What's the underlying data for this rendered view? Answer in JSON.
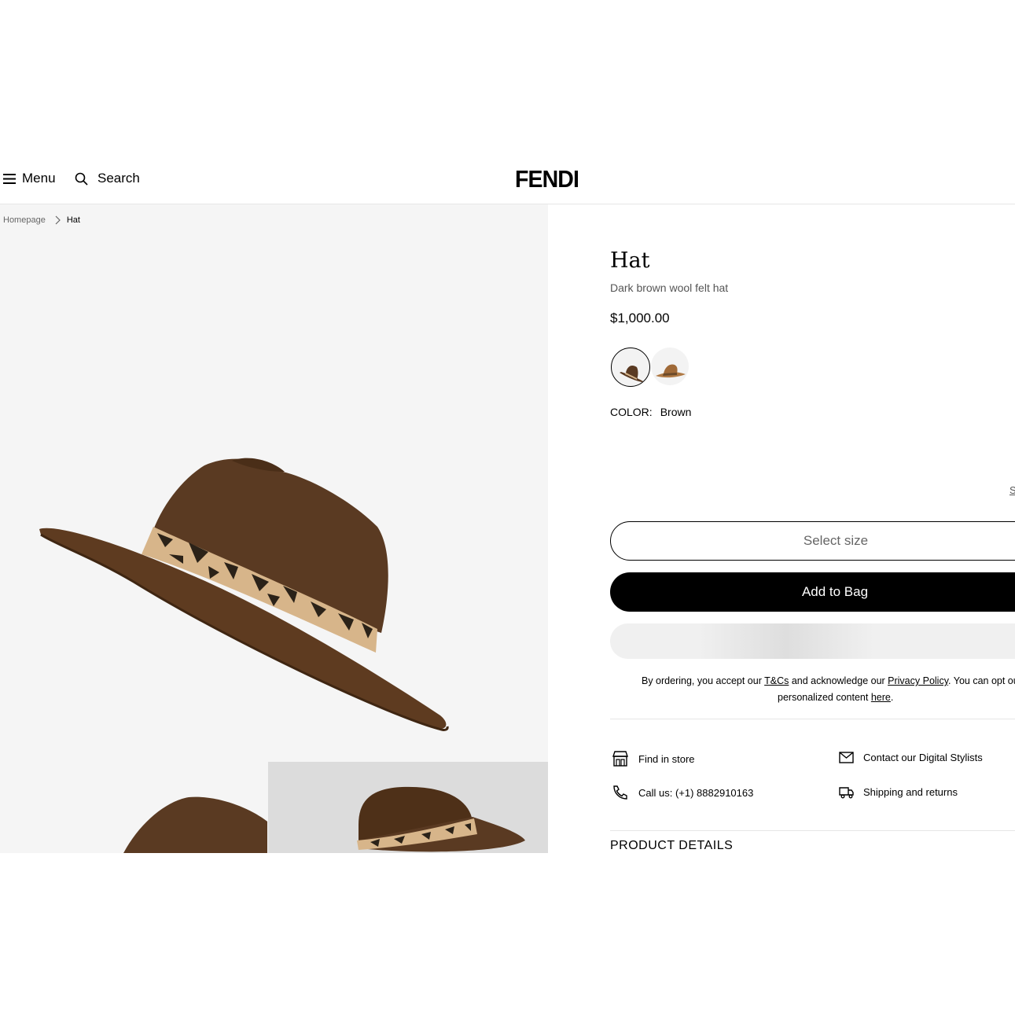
{
  "header": {
    "menu_label": "Menu",
    "search_label": "Search",
    "logo": "FENDI"
  },
  "breadcrumb": {
    "items": [
      "Homepage",
      "Hat"
    ]
  },
  "product": {
    "title": "Hat",
    "subtitle": "Dark brown wool felt hat",
    "price": "$1,000.00",
    "color_label": "COLOR:",
    "color_value": "Brown",
    "swatches": [
      "Dark brown",
      "Tan"
    ],
    "size_guide_label": "S"
  },
  "actions": {
    "select_size": "Select size",
    "add_to_bag": "Add to Bag"
  },
  "legal": {
    "prefix": "By ordering, you accept our ",
    "tcs": "T&Cs",
    "mid": " and acknowledge our ",
    "privacy": "Privacy Policy",
    "suffix": ". You can opt ou",
    "line2_prefix": "personalized content ",
    "here": "here",
    "line2_suffix": "."
  },
  "services": {
    "find_in_store": "Find in store",
    "contact": "Contact our Digital Stylists",
    "call": "Call us: (+1) 8882910163",
    "shipping": "Shipping and returns"
  },
  "details_heading": "PRODUCT DETAILS",
  "colors": {
    "hat_brown": "#5a3a22",
    "band_light": "#d9b98a",
    "band_dark": "#2b2218"
  }
}
